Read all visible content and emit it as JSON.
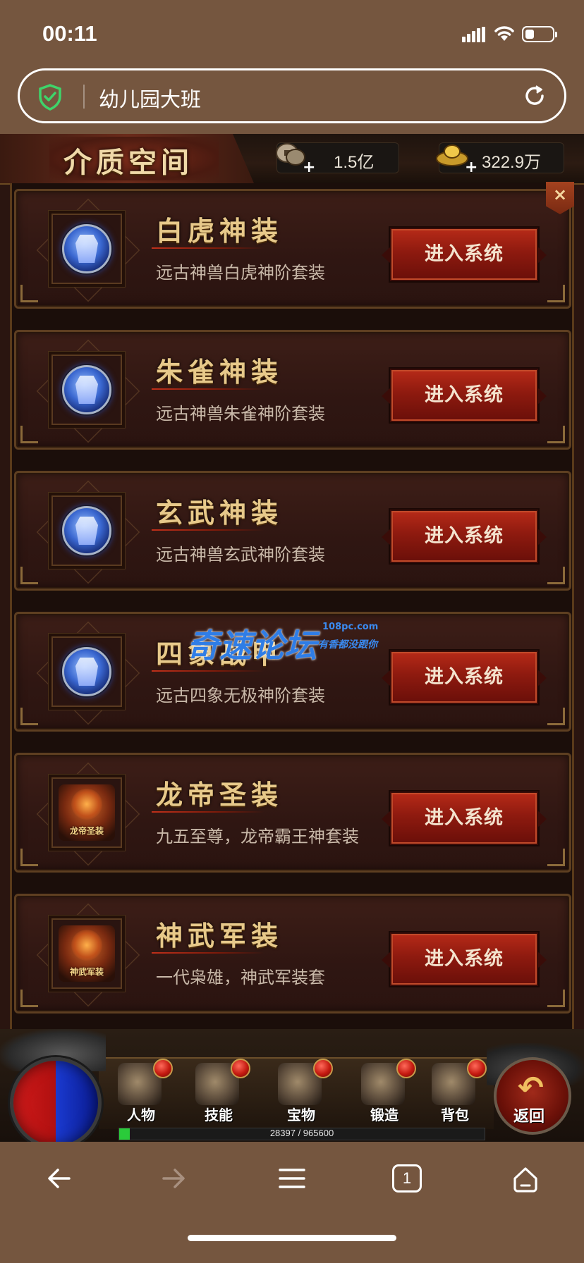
{
  "status_bar": {
    "time": "00:11"
  },
  "browser": {
    "address": "幼儿园大班",
    "icons": {
      "security": "shield-check-icon",
      "reload": "reload-icon"
    },
    "toolbar": [
      "back-arrow-icon",
      "forward-arrow-icon",
      "menu-icon",
      "tabs-icon",
      "home-icon"
    ],
    "tab_count": "1"
  },
  "game": {
    "title": "介质空间",
    "currencies": [
      {
        "name": "copper",
        "icon": "copper-coin-icon",
        "value": "1.5亿"
      },
      {
        "name": "gold",
        "icon": "gold-ingot-icon",
        "value": "322.9万"
      }
    ],
    "close_label": "×",
    "systems": [
      {
        "title": "白虎神装",
        "description": "远古神兽白虎神阶套装",
        "button": "进入系统",
        "icon": "white-tiger-armor-icon"
      },
      {
        "title": "朱雀神装",
        "description": "远古神兽朱雀神阶套装",
        "button": "进入系统",
        "icon": "vermilion-bird-armor-icon"
      },
      {
        "title": "玄武神装",
        "description": "远古神兽玄武神阶套装",
        "button": "进入系统",
        "icon": "black-tortoise-armor-icon"
      },
      {
        "title": "四象战甲",
        "description": "远古四象无极神阶套装",
        "button": "进入系统",
        "icon": "four-symbols-armor-icon"
      },
      {
        "title": "龙帝圣装",
        "description": "九五至尊，龙帝霸王神套装",
        "button": "进入系统",
        "icon": "dragon-emperor-icon",
        "badge": "龙帝圣装"
      },
      {
        "title": "神武军装",
        "description": "一代枭雄，神武军装套",
        "button": "进入系统",
        "icon": "divine-military-icon",
        "badge": "神武军装"
      }
    ],
    "watermark": {
      "main": "奇速论坛",
      "site": "108pc.com",
      "slogan": "有香都没跟你"
    },
    "bottom_menu": [
      {
        "label": "人物",
        "icon": "helmet-icon"
      },
      {
        "label": "技能",
        "icon": "skill-book-icon"
      },
      {
        "label": "宝物",
        "icon": "treasure-pot-icon"
      },
      {
        "label": "锻造",
        "icon": "anvil-icon"
      },
      {
        "label": "背包",
        "icon": "bag-icon"
      }
    ],
    "back_button": {
      "label": "返回",
      "icon": "return-arrow-icon"
    },
    "experience": {
      "current": 28397,
      "max": 965600,
      "text": "28397 / 965600"
    },
    "colors": {
      "accent_red": "#8e1a0f",
      "gold_text": "#e7c98a",
      "browser_chrome": "#75563f",
      "exp_green": "#2acb3a"
    }
  }
}
